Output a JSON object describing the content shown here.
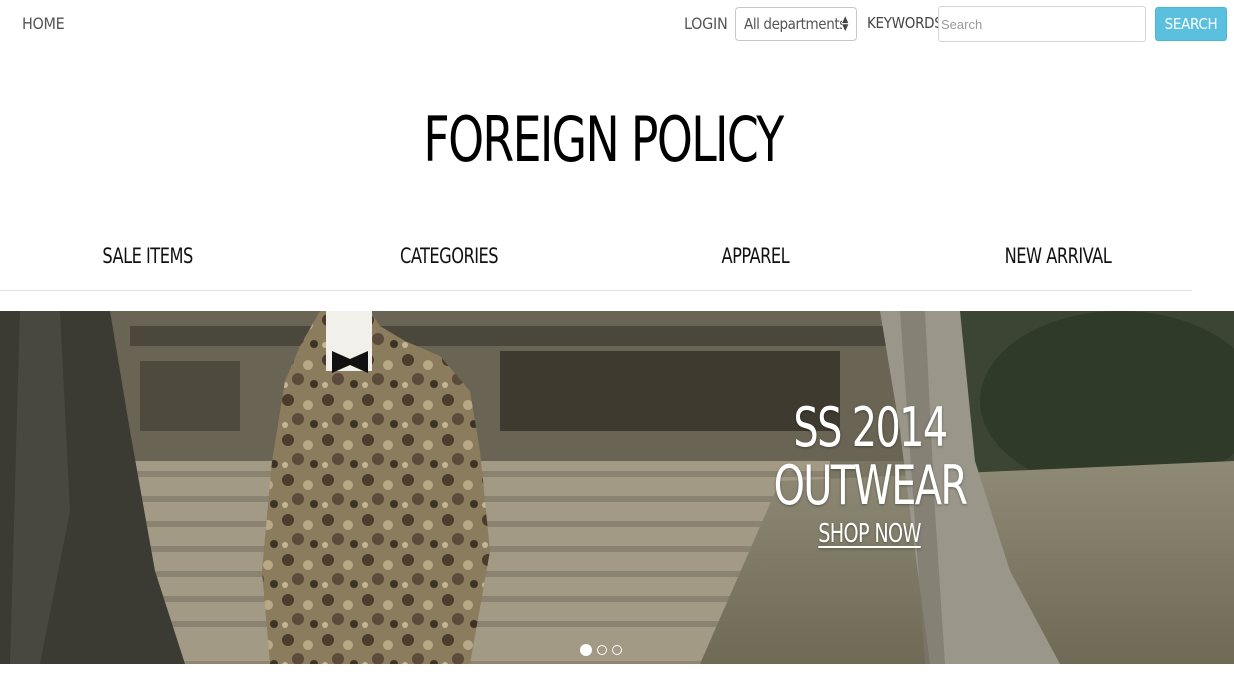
{
  "header": {
    "home_label": "HOME",
    "login_label": "LOGIN",
    "department_select": {
      "selected": "All departments"
    },
    "keywords_label": "KEYWORDS",
    "search": {
      "placeholder": "Search",
      "value": ""
    },
    "search_button_label": "SEARCH"
  },
  "site_title": "FOREIGN POLICY",
  "nav": {
    "items": [
      {
        "label": "SALE ITEMS"
      },
      {
        "label": "CATEGORIES"
      },
      {
        "label": "APPAREL"
      },
      {
        "label": "NEW ARRIVAL"
      }
    ]
  },
  "hero": {
    "line1": "SS 2014",
    "line2": "OUTWEAR",
    "cta_label": "SHOP NOW",
    "slide_count": 3,
    "active_slide": 1
  },
  "colors": {
    "search_button": "#5bc0de",
    "text": "#111111",
    "muted_text": "#555555"
  }
}
